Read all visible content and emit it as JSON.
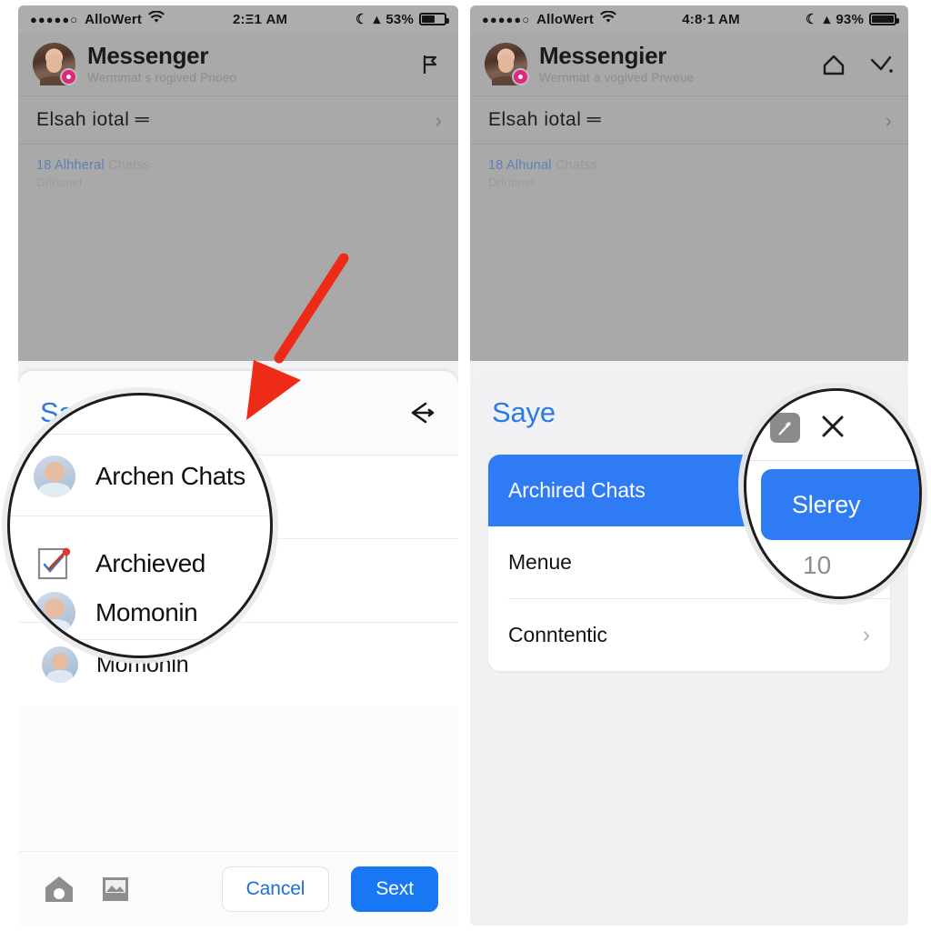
{
  "phones": [
    {
      "id": "left",
      "status_bar": {
        "signal_dots": "●●●●●○",
        "carrier": "AlloWert",
        "wifi_icon": "wifi-icon",
        "time": "2:Ξ1 AM",
        "glyph_1": "moon-icon",
        "glyph_2": "location-icon",
        "battery_percent": "53%",
        "battery_level": 53
      },
      "header": {
        "avatar": "user-avatar",
        "badge": "notification-badge",
        "title": "Messenger",
        "subtitle": "Wermmat s rogived Pnoeo",
        "icons": [
          "flag-icon"
        ]
      },
      "search_row": {
        "text": "Elsah iotal ═",
        "chevron": "chevron-right-icon"
      },
      "list_info": {
        "highlight": "18 Alhheral",
        "rest": " Chatss",
        "second_line": "Drlrionel"
      },
      "sheet": {
        "title": "Saye",
        "head_icons": [
          "share-icon"
        ],
        "rows": [
          {
            "icon": "mini-avatar",
            "label": "Archen Chats"
          },
          {
            "icon": "compose-icon",
            "label": "Archieved"
          },
          {
            "icon": "mini-avatar",
            "label": "Momonin"
          }
        ]
      },
      "toolbar": {
        "icons": [
          "camera-icon",
          "photo-icon"
        ],
        "cancel_label": "Cancel",
        "primary_label": "Sext"
      },
      "magnifier": {
        "shape": "circle",
        "rows": [
          {
            "icon": "mini-avatar",
            "label": "Archen Chats"
          },
          {
            "icon": "compose-icon",
            "label": "Archieved"
          },
          {
            "icon": "mini-avatar",
            "label": "Momonin"
          }
        ]
      },
      "annotation": {
        "arrow": "red-arrow-pointing-down-left"
      }
    },
    {
      "id": "right",
      "status_bar": {
        "signal_dots": "●●●●●○",
        "carrier": "AlloWert",
        "wifi_icon": "wifi-icon",
        "time": "4:8·1 AM",
        "glyph_1": "moon-icon",
        "glyph_2": "location-icon",
        "battery_percent": "93%",
        "battery_level": 93
      },
      "header": {
        "avatar": "user-avatar",
        "badge": "notification-badge",
        "title": "Messengier",
        "subtitle": "Wernmat a vogived Prweue",
        "icons": [
          "home-icon",
          "compose-icon"
        ]
      },
      "search_row": {
        "text": "Elsah iotal ═",
        "chevron": "chevron-right-icon"
      },
      "list_info": {
        "highlight": "18 Alhunal",
        "rest": " Chatss",
        "second_line": "Drlrionel"
      },
      "sheet": {
        "title": "Saye",
        "head_icons": [
          "wand-icon",
          "close-icon"
        ],
        "rows": [
          {
            "label": "Archired Chats",
            "selected": true,
            "value": ""
          },
          {
            "label": "Menue",
            "selected": false,
            "value": "10"
          },
          {
            "label": "Conntentic",
            "selected": false,
            "value": "",
            "chevron": "chevron-right-icon"
          }
        ]
      },
      "magnifier": {
        "shape": "blob",
        "icons": [
          "wand-icon",
          "close-icon"
        ],
        "selected_label": "Slerey",
        "value": "10"
      }
    }
  ],
  "colors": {
    "accent_blue": "#2f7bf4",
    "link_blue": "#2a7ae4",
    "primary_button": "#1877f2",
    "badge_pink": "#e0277e",
    "arrow_red": "#ee2b16",
    "status_bar_grey": "#adadad",
    "app_body_grey": "#a9a9a9"
  }
}
